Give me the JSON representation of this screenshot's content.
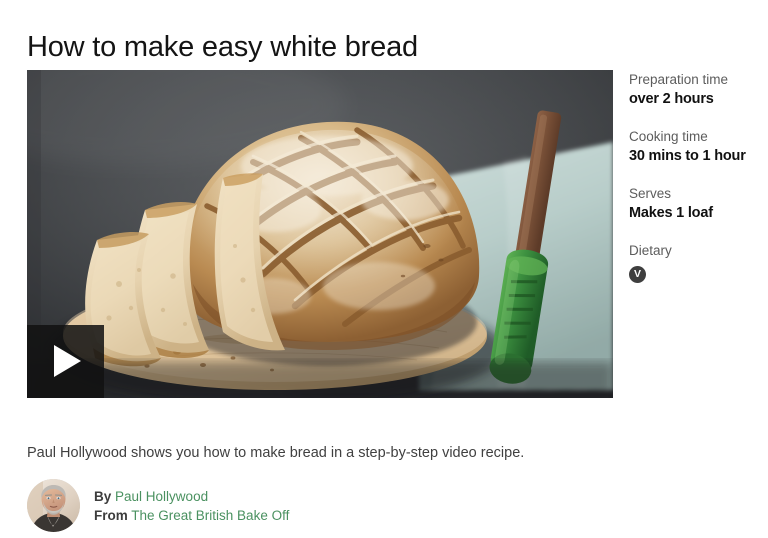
{
  "page": {
    "title": "How to make easy white bread",
    "background_color": "#ffffff",
    "link_color": "#4a9160"
  },
  "media": {
    "alt": "A round crusty white loaf with slashed scoring, sliced pieces on a wooden board, a green-handled knife resting on a pale teal ribbed cloth",
    "play_button_label": "Play video",
    "play_icon": "play-triangle-icon"
  },
  "meta": {
    "items": [
      {
        "label": "Preparation time",
        "value": "over 2 hours"
      },
      {
        "label": "Cooking time",
        "value": "30 mins to 1 hour"
      },
      {
        "label": "Serves",
        "value": "Makes 1 loaf"
      }
    ],
    "dietary": {
      "label": "Dietary",
      "badges": [
        {
          "letter": "V",
          "name": "vegetarian-badge",
          "color": "#3f3f3f"
        }
      ]
    }
  },
  "description": "Paul Hollywood shows you how to make bread in a step-by-step video recipe.",
  "author": {
    "avatar_alt": "Portrait of Paul Hollywood",
    "by_prefix": "By",
    "name": "Paul Hollywood",
    "from_prefix": "From",
    "programme": "The Great British Bake Off"
  }
}
